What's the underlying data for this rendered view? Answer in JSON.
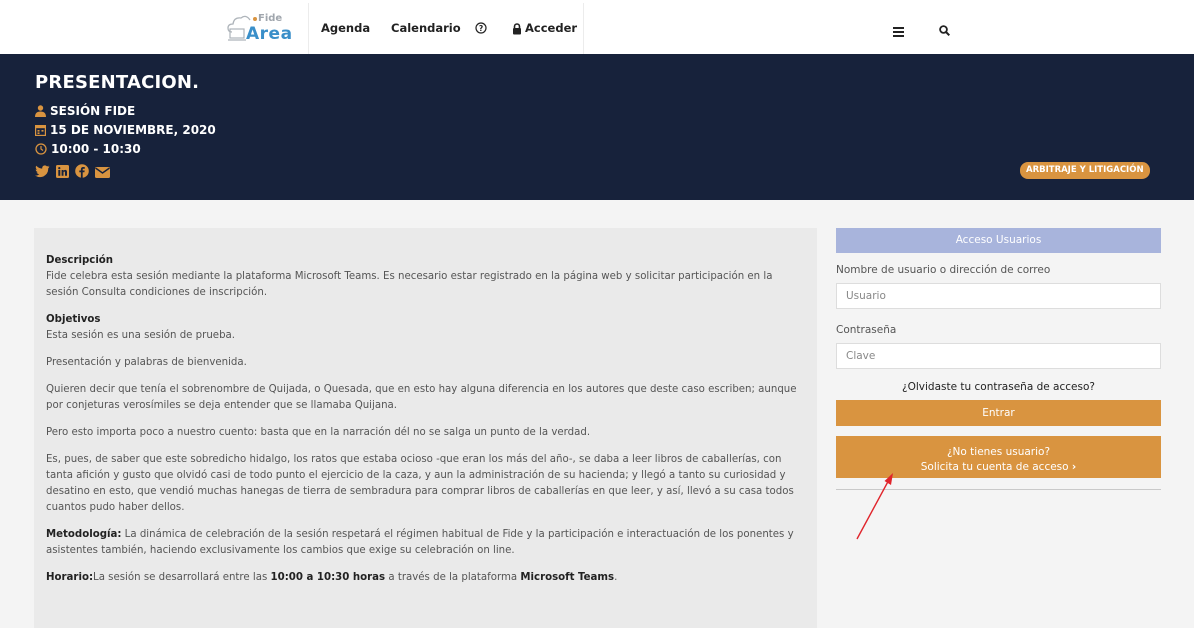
{
  "nav": {
    "logo_top": "Fide",
    "logo_bottom": "Area",
    "items": [
      "Agenda",
      "Calendario",
      "Acceder"
    ],
    "icons": [
      "help-circle-icon",
      "lock-icon",
      "menu-icon",
      "search-icon"
    ]
  },
  "hero": {
    "title": "PRESENTACION.",
    "speaker": "SESIÓN FIDE",
    "date": "15 DE NOVIEMBRE, 2020",
    "time": "10:00 - 10:30",
    "category": "ARBITRAJE Y LITIGACIÓN",
    "social_icons": [
      "twitter-icon",
      "linkedin-icon",
      "facebook-icon",
      "email-icon"
    ]
  },
  "article": {
    "desc_title": "Descripción",
    "desc_text": "Fide celebra esta sesión mediante la plataforma Microsoft Teams. Es necesario estar registrado en la página web y solicitar participación en la sesión Consulta condiciones de inscripción.",
    "obj_title": "Objetivos",
    "obj_text": "Esta sesión es una sesión de prueba.",
    "p1": "Presentación y palabras de bienvenida.",
    "p2": "Quieren decir que tenía el sobrenombre de Quijada, o Quesada, que en esto hay alguna diferencia en los autores que deste caso escriben; aunque por conjeturas verosímiles se deja entender que se llamaba Quijana.",
    "p3": "Pero esto importa poco a nuestro cuento: basta que en la narración dél no se salga un punto de la verdad.",
    "p4": "Es, pues, de saber que este sobredicho hidalgo, los ratos que estaba ocioso -que eran los más del año-, se daba a leer libros de caballerías, con tanta afición y gusto que olvidó casi de todo punto el ejercicio de la caza, y aun la administración de su hacienda; y llegó a tanto su curiosidad y desatino en esto, que vendió muchas hanegas de tierra de sembradura para comprar libros de caballerías en que leer, y así, llevó a su casa todos cuantos pudo haber dellos.",
    "meth_label": "Metodología:",
    "meth_text": " La dinámica de celebración de la sesión respetará el régimen habitual de Fide y la participación e interactuación de los ponentes y asistentes también, haciendo exclusivamente los cambios que exige su celebración on line.",
    "hor_label": "Horario:",
    "hor_text1": "La sesión se desarrollará entre las ",
    "hor_bold1": "10:00 a 10:30 horas",
    "hor_text2": " a través de la plataforma ",
    "hor_bold2": "Microsoft Teams",
    "hor_end": "."
  },
  "login": {
    "header": "Acceso Usuarios",
    "user_label": "Nombre de usuario o dirección de correo",
    "user_placeholder": "Usuario",
    "pass_label": "Contraseña",
    "pass_placeholder": "Clave",
    "forgot": "¿Olvidaste tu contraseña de acceso?",
    "enter": "Entrar",
    "register_line1": "¿No tienes usuario?",
    "register_line2": "Solicita tu cuenta de acceso",
    "register_chevron": "›"
  },
  "colors": {
    "hero_bg": "#17223b",
    "accent": "#d99440",
    "login_header": "#a8b4dc",
    "annotation": "#e0242b"
  }
}
